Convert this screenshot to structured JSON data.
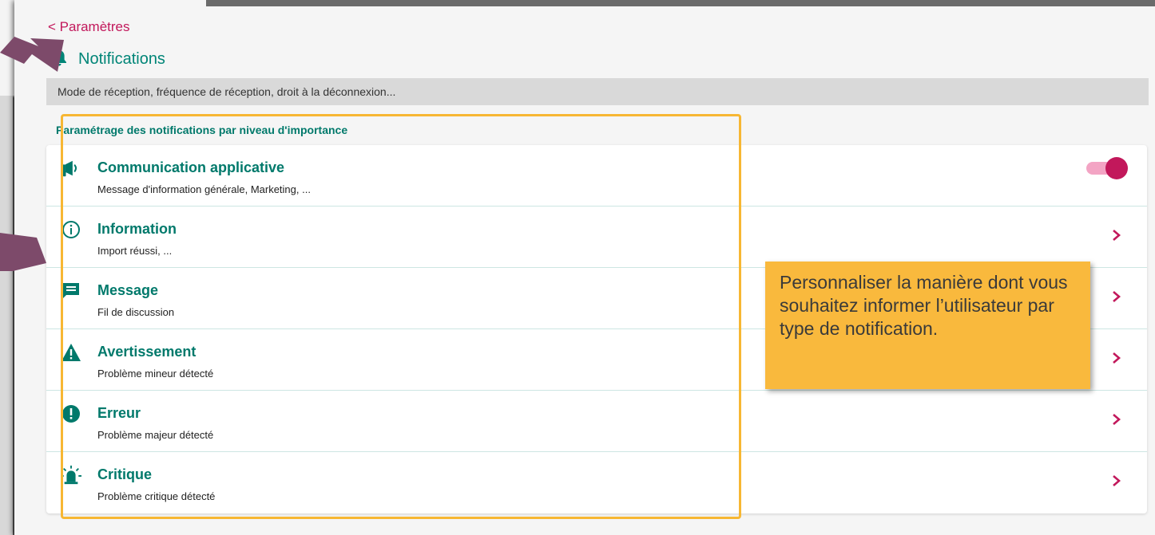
{
  "header": {
    "back_label": "< Paramètres",
    "title": "Notifications",
    "title_icon": "bell-icon",
    "subtitle": "Mode de réception, fréquence de réception, droit à la déconnexion..."
  },
  "section": {
    "label": "Paramétrage des notifications par niveau d'importance"
  },
  "rows": [
    {
      "icon": "megaphone-icon",
      "title": "Communication applicative",
      "description": "Message d'information générale, Marketing, ...",
      "control": "toggle",
      "toggle_on": true
    },
    {
      "icon": "info-icon",
      "title": "Information",
      "description": "Import réussi, ...",
      "control": "chevron"
    },
    {
      "icon": "message-icon",
      "title": "Message",
      "description": "Fil de discussion",
      "control": "chevron"
    },
    {
      "icon": "warning-icon",
      "title": "Avertissement",
      "description": "Problème mineur détecté",
      "control": "chevron"
    },
    {
      "icon": "error-icon",
      "title": "Erreur",
      "description": "Problème majeur détecté",
      "control": "chevron"
    },
    {
      "icon": "siren-icon",
      "title": "Critique",
      "description": "Problème critique détecté",
      "control": "chevron"
    }
  ],
  "callout": {
    "text": "Personnaliser la manière dont vous souhaitez informer l’utilisateur par type de notification."
  },
  "colors": {
    "teal": "#00796b",
    "accent": "#c2185b",
    "highlight": "#f7b733",
    "callout_bg": "#f9b93d",
    "annotation_arrow": "#7d4a6a"
  }
}
